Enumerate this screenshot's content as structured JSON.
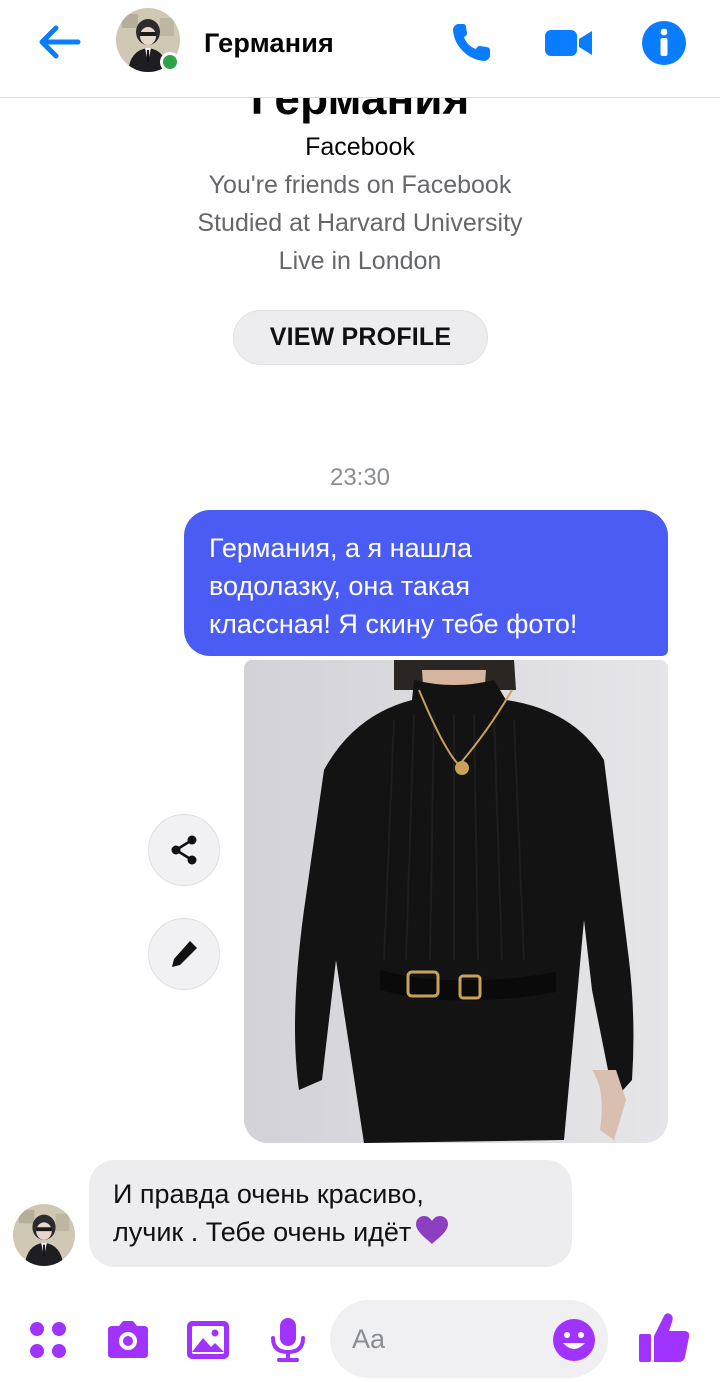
{
  "header": {
    "contact_name": "Германия",
    "online": true
  },
  "intro": {
    "name": "Германия",
    "platform": "Facebook",
    "friends_line": "You're friends on Facebook",
    "education_line": "Studied at Harvard University",
    "location_line": "Live in London",
    "view_profile_label": "VIEW PROFILE"
  },
  "thread": {
    "timestamp": "23:30",
    "outgoing_message": "Германия, а я нашла\nводолазку, она такая\nклассная! Я скину тебе фото!",
    "incoming_message": "И правда очень красиво,\nлучик . Тебе очень идёт"
  },
  "composer": {
    "placeholder": "Aa"
  },
  "colors": {
    "header_accent": "#0a7cff",
    "outgoing_bubble": "#4b5cf5",
    "composer_accent": "#a033ff",
    "online": "#31a24c"
  },
  "icons": {
    "back": "arrow-left-icon",
    "call": "phone-icon",
    "video": "video-camera-icon",
    "info": "info-icon",
    "share": "share-icon",
    "edit": "pencil-icon",
    "more": "four-dots-icon",
    "camera": "camera-icon",
    "gallery": "image-icon",
    "mic": "microphone-icon",
    "emoji": "smiley-icon",
    "like": "thumbs-up-icon",
    "heart": "purple-heart-icon"
  }
}
